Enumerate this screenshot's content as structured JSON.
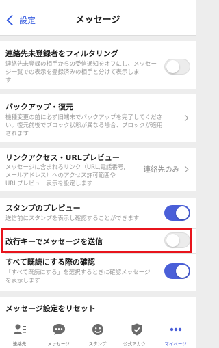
{
  "header": {
    "back_label": "設定",
    "title": "メッセージ"
  },
  "settings": {
    "filter": {
      "title": "連絡先未登録者をフィルタリング",
      "desc_1": "連絡先未登録の相手からの受信通知をオフにし、メッセー",
      "desc_2": "ジ一覧での表示を登録済みの相手と分けて表示しま",
      "desc_3": "す",
      "state": "off"
    },
    "backup": {
      "title": "バックアップ・復元",
      "desc_1": "機種変更の前に必ず旧端末でバックアップを完了してくださ",
      "desc_2": "い。復元前後でブロック状態が異なる場合、ブロックが適用",
      "desc_3": "されます"
    },
    "link_preview": {
      "title": "リンクアクセス・URLプレビュー",
      "desc_1": "メッセージに含まれるリンク（URL,電話番号,",
      "desc_2": "メールアドレス）へのアクセス許可範囲や",
      "desc_3": "URLプレビュー表示を設定します",
      "value": "連絡先のみ"
    },
    "stamp_preview": {
      "title": "スタンプのプレビュー",
      "desc_1": "送信前にスタンプを表示し確認することができます",
      "state": "on"
    },
    "enter_send": {
      "title": "改行キーでメッセージを送信",
      "state": "off"
    },
    "mark_all_read": {
      "title": "すべて既読にする際の確認",
      "desc_1": "「すべて既読にする」を選択するときに確認メッセージ",
      "desc_2": "を表示します",
      "state": "on"
    },
    "reset": {
      "title": "メッセージ設定をリセット"
    }
  },
  "tabbar": {
    "tabs": [
      {
        "label": "連絡先",
        "icon": "contacts-icon"
      },
      {
        "label": "メッセージ",
        "icon": "message-icon"
      },
      {
        "label": "スタンプ",
        "icon": "stamp-icon"
      },
      {
        "label": "公式アカウ…",
        "icon": "official-account-icon"
      },
      {
        "label": "マイページ",
        "icon": "mypage-icon",
        "active": true
      }
    ]
  },
  "colors": {
    "accent": "#4a5fd8",
    "link": "#3a5fe0",
    "highlight": "#e8141c",
    "background": "#ededed"
  }
}
